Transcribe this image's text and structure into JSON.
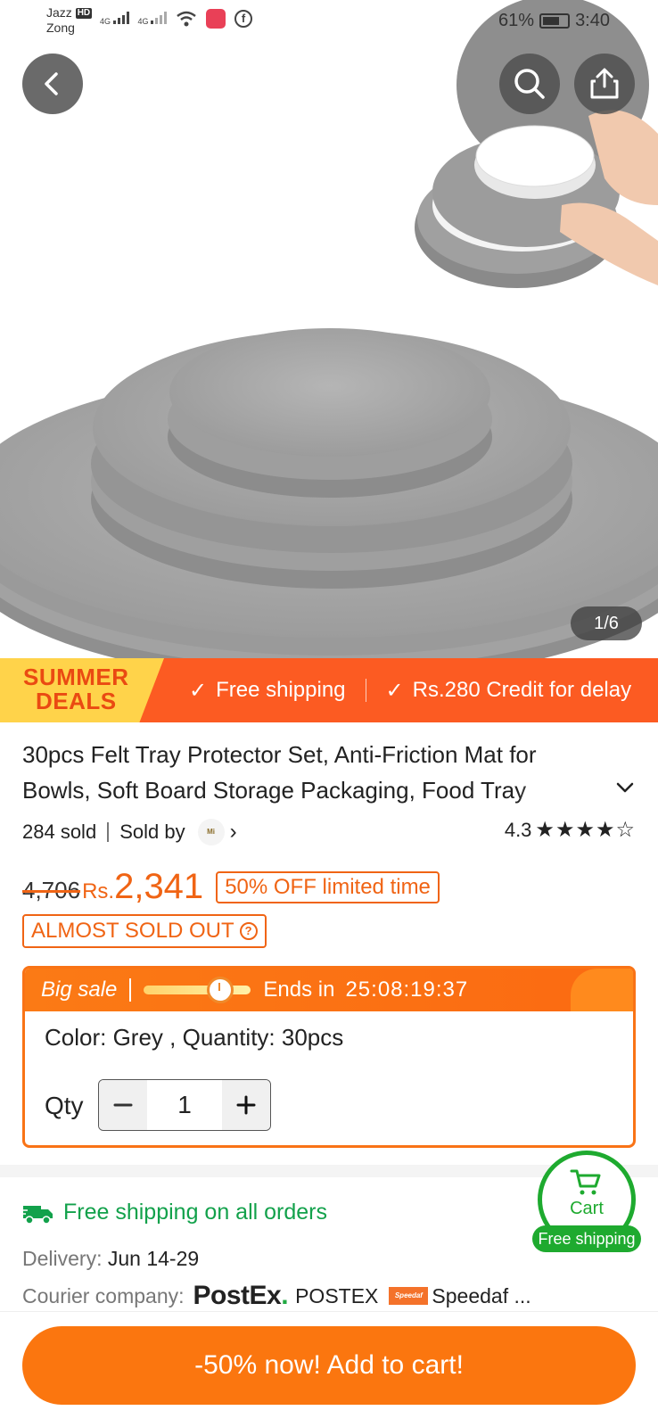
{
  "status_bar": {
    "carrier1": "Jazz",
    "carrier1_badge": "HD",
    "carrier2": "Zong",
    "network1": "4G",
    "network2": "4G",
    "battery": "61%",
    "time": "3:40"
  },
  "gallery": {
    "counter": "1/6"
  },
  "promo": {
    "badge_line1": "SUMMER",
    "badge_line2": "DEALS",
    "item1": "Free shipping",
    "item2": "Rs.280 Credit for delay"
  },
  "product": {
    "title": "30pcs Felt Tray Protector Set, Anti-Friction Mat for Bowls, Soft Board Storage Packaging, Food Tray",
    "sold": "284 sold",
    "sold_by": "Sold by",
    "rating": "4.3",
    "stars": "★★★★☆",
    "old_price": "4,706",
    "currency": "Rs.",
    "price": "2,341",
    "discount": "50% OFF limited time",
    "stock_badge": "ALMOST SOLD OUT"
  },
  "sale": {
    "label": "Big sale",
    "progress": 0.72,
    "ends_label": "Ends in",
    "timer": "25:08:19:37",
    "variant": "Color: Grey , Quantity: 30pcs",
    "qty_label": "Qty",
    "qty_value": "1"
  },
  "shipping": {
    "headline": "Free shipping on all orders",
    "delivery_label": "Delivery: ",
    "delivery_value": "Jun 14-29",
    "courier_label": "Courier company:",
    "courier_logo": "PostEx",
    "courier1": "POSTEX",
    "courier2_logo": "Speedaf",
    "courier2": "Speedaf ..."
  },
  "cart": {
    "label": "Cart",
    "badge": "Free shipping"
  },
  "cta": {
    "label": "-50% now! Add to cart!"
  },
  "colors": {
    "accent": "#f06414",
    "promo_bg": "#fc5b22",
    "cta_bg": "#fb760f",
    "green": "#1eaa2f"
  }
}
